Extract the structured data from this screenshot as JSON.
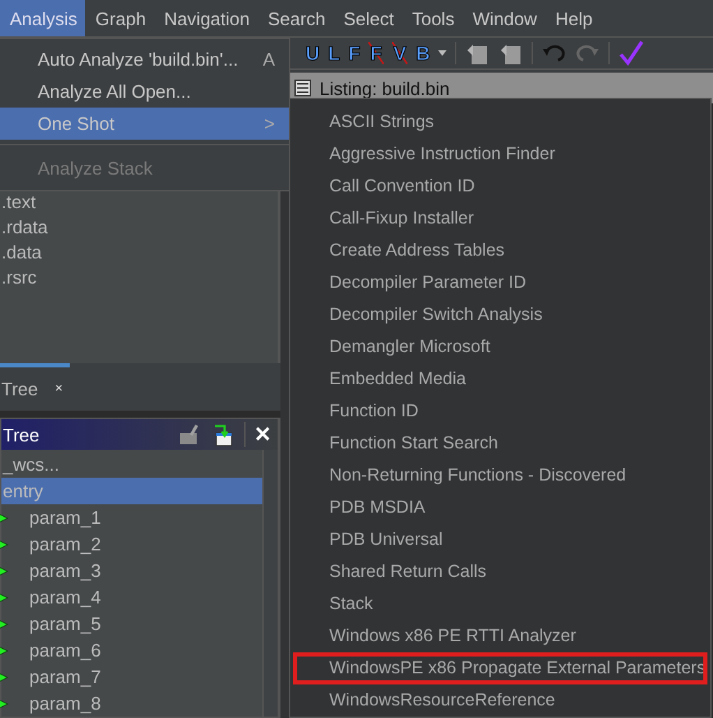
{
  "menu_bar": [
    {
      "label": "Analysis",
      "selected": true
    },
    {
      "label": "Graph",
      "selected": false
    },
    {
      "label": "Navigation",
      "selected": false
    },
    {
      "label": "Search",
      "selected": false
    },
    {
      "label": "Select",
      "selected": false
    },
    {
      "label": "Tools",
      "selected": false
    },
    {
      "label": "Window",
      "selected": false
    },
    {
      "label": "Help",
      "selected": false
    }
  ],
  "analysis_menu": [
    {
      "kind": "item",
      "label": "Auto Analyze 'build.bin'...",
      "shortcut": "A",
      "selected": false,
      "disabled": false
    },
    {
      "kind": "item",
      "label": "Analyze All Open...",
      "selected": false,
      "disabled": false
    },
    {
      "kind": "submenu",
      "label": "One Shot",
      "arrow": ">",
      "selected": true,
      "disabled": false
    },
    {
      "kind": "separator"
    },
    {
      "kind": "item",
      "label": "Analyze Stack",
      "selected": false,
      "disabled": true
    }
  ],
  "toolbar": [
    {
      "kind": "letter",
      "label": "U",
      "crossed": false
    },
    {
      "kind": "letter",
      "label": "L",
      "crossed": false
    },
    {
      "kind": "letter",
      "label": "F",
      "crossed": false
    },
    {
      "kind": "letter",
      "label": "F",
      "crossed": true
    },
    {
      "kind": "letter",
      "label": "V",
      "crossed": true
    },
    {
      "kind": "letter",
      "label": "B",
      "crossed": false
    },
    {
      "kind": "caret"
    },
    {
      "kind": "separator"
    },
    {
      "kind": "doc"
    },
    {
      "kind": "doc"
    },
    {
      "kind": "separator"
    },
    {
      "kind": "undo"
    },
    {
      "kind": "redo"
    },
    {
      "kind": "separator"
    },
    {
      "kind": "check"
    }
  ],
  "listing": {
    "title": "Listing:  build.bin"
  },
  "program_tree": {
    "items": [
      ".text",
      ".rdata",
      ".data",
      ".rsrc"
    ],
    "tab": {
      "label": "Tree",
      "close": "×"
    }
  },
  "symbol_tree": {
    "title": "Tree",
    "close": "✕",
    "items": [
      {
        "label": "_wcs...",
        "kind": "plain",
        "selected": false
      },
      {
        "label": "entry",
        "kind": "plain",
        "selected": true
      },
      {
        "label": "param_1",
        "kind": "param",
        "selected": false
      },
      {
        "label": "param_2",
        "kind": "param",
        "selected": false
      },
      {
        "label": "param_3",
        "kind": "param",
        "selected": false
      },
      {
        "label": "param_4",
        "kind": "param",
        "selected": false
      },
      {
        "label": "param_5",
        "kind": "param",
        "selected": false
      },
      {
        "label": "param_6",
        "kind": "param",
        "selected": false
      },
      {
        "label": "param_7",
        "kind": "param",
        "selected": false
      },
      {
        "label": "param_8",
        "kind": "param",
        "selected": false
      }
    ]
  },
  "one_shot_menu": [
    {
      "label": "ASCII Strings",
      "outlined": false
    },
    {
      "label": "Aggressive Instruction Finder",
      "outlined": false
    },
    {
      "label": "Call Convention ID",
      "outlined": false
    },
    {
      "label": "Call-Fixup Installer",
      "outlined": false
    },
    {
      "label": "Create Address Tables",
      "outlined": false
    },
    {
      "label": "Decompiler Parameter ID",
      "outlined": false
    },
    {
      "label": "Decompiler Switch Analysis",
      "outlined": false
    },
    {
      "label": "Demangler Microsoft",
      "outlined": false
    },
    {
      "label": "Embedded Media",
      "outlined": false
    },
    {
      "label": "Function ID",
      "outlined": false
    },
    {
      "label": "Function Start Search",
      "outlined": false
    },
    {
      "label": "Non-Returning Functions - Discovered",
      "outlined": false
    },
    {
      "label": "PDB MSDIA",
      "outlined": false
    },
    {
      "label": "PDB Universal",
      "outlined": false
    },
    {
      "label": "Shared Return Calls",
      "outlined": false
    },
    {
      "label": "Stack",
      "outlined": false
    },
    {
      "label": "Windows x86 PE RTTI Analyzer",
      "outlined": false
    },
    {
      "label": "WindowsPE x86 Propagate External Parameters",
      "outlined": true
    },
    {
      "label": "WindowsResourceReference",
      "outlined": false
    }
  ]
}
